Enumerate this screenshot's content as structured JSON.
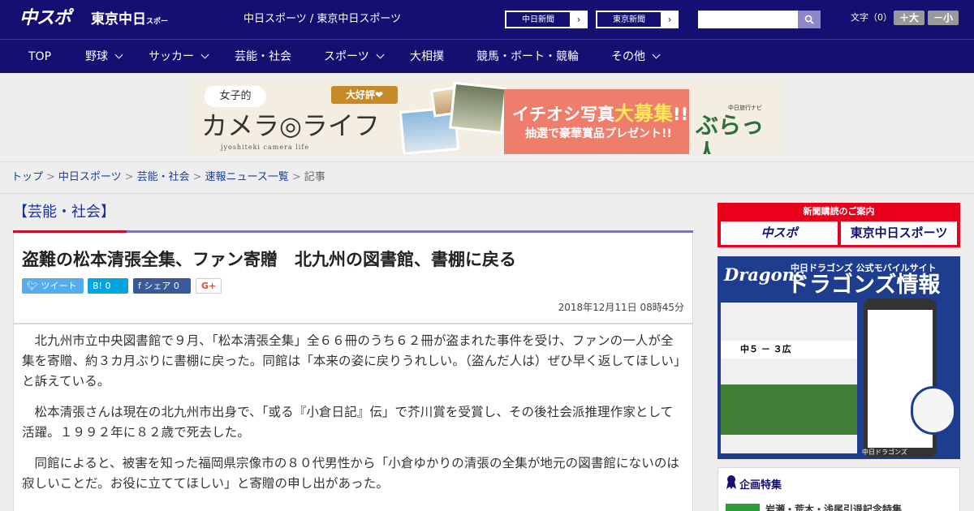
{
  "header": {
    "logo_chusupo": "中スポ",
    "logo_tokyo": "東京中日",
    "logo_tokyo_small": "スポーツ",
    "site_names": "中日スポーツ / 東京中日スポーツ",
    "links": [
      "中日新聞",
      "東京新聞"
    ],
    "link_arrow": "›",
    "search_placeholder": "",
    "font_size_label": "文字（0）",
    "font_larger": "＋大",
    "font_smaller": "－小"
  },
  "nav": {
    "items": [
      {
        "label": "TOP"
      },
      {
        "label": "野球"
      },
      {
        "label": "サッカー"
      },
      {
        "label": "芸能・社会"
      },
      {
        "label": "スポーツ"
      },
      {
        "label": "大相撲"
      },
      {
        "label": "競馬・ボート・競輪"
      },
      {
        "label": "その他"
      }
    ]
  },
  "banner": {
    "joshi": "女子的",
    "daikohyo": "大好評❤",
    "title": "カメラ◎ライフ",
    "subtitle": "jyoshiteki camera life",
    "line1_a": "イチオシ写真",
    "line1_b": "大募集",
    "line1_c": "!!",
    "line2": "抽選で豪華賞品プレゼント!!",
    "navi": "中日旅行ナビ",
    "brand": "ぶらっ人"
  },
  "breadcrumb": {
    "items": [
      "トップ",
      "中日スポーツ",
      "芸能・社会",
      "速報ニュース一覧"
    ],
    "current": "記事",
    "sep": ">"
  },
  "article": {
    "category": "【芸能・社会】",
    "headline": "盗難の松本清張全集、ファン寄贈　北九州の図書館、書棚に戻る",
    "share": {
      "tweet": "ツイート",
      "hatena": "B! 0",
      "facebook": "f シェア 0",
      "gplus": "G+"
    },
    "date": "2018年12月11日 08時45分",
    "paragraphs": [
      "北九州市立中央図書館で９月、「松本清張全集」全６６冊のうち６２冊が盗まれた事件を受け、ファンの一人が全集を寄贈、約３カ月ぶりに書棚に戻った。同館は「本来の姿に戻りうれしい。（盗んだ人は）ぜひ早く返してほしい」と訴えている。",
      "松本清張さんは現在の北九州市出身で、「或る『小倉日記』伝」で芥川賞を受賞し、その後社会派推理作家として活躍。１９９２年に８２歳で死去した。",
      "同館によると、被害を知った福岡県宗像市の８０代男性から「小倉ゆかりの清張の全集が地元の図書館にないのは寂しいことだ。お役に立ててほしい」と寄贈の申し出があった。"
    ]
  },
  "sidebar": {
    "subscribe_header": "新聞購読のご案内",
    "subscribe_a": "中スポ",
    "subscribe_b": "東京中日スポーツ",
    "dragons_logo": "Dragons",
    "dragons_t1": "中日ドラゴンズ 公式モバイルサイト",
    "dragons_t2": "ドラゴンズ情報",
    "dragons_score": "中５ － ３広",
    "dragons_foot": "中日ドラゴンズ",
    "kikaku_title": "企画特集",
    "kikaku_item": "岩瀬・荒木・浅尾引退記念特集"
  }
}
